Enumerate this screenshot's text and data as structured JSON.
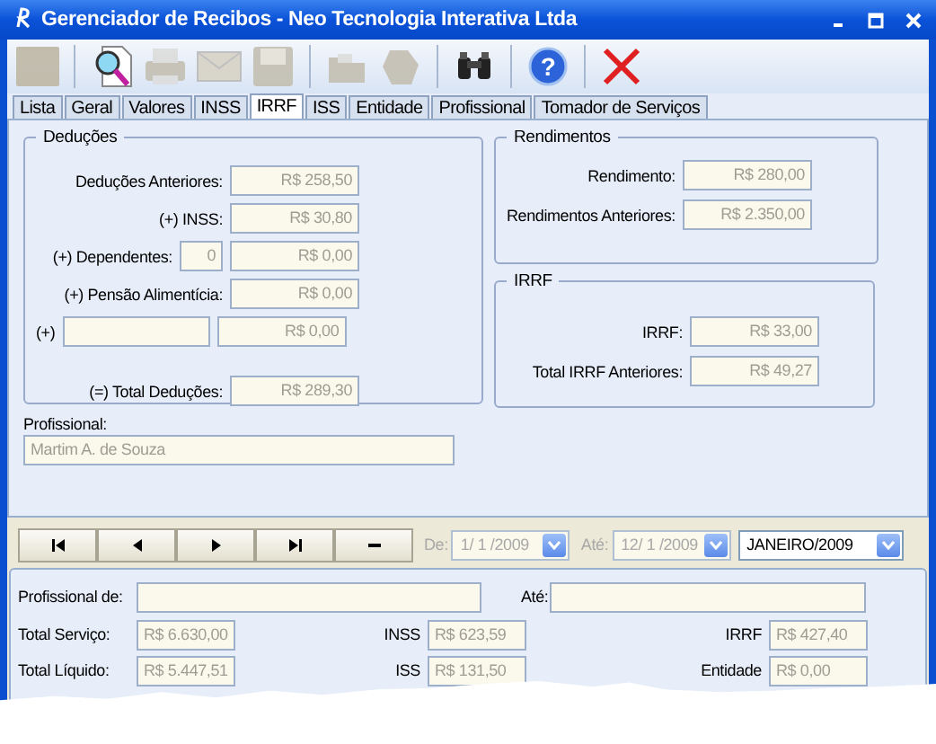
{
  "window": {
    "title": "Gerenciador de Recibos - Neo Tecnologia Interativa Ltda"
  },
  "toolbar": [
    {
      "kind": "blank",
      "disabled": true
    },
    {
      "kind": "preview",
      "disabled": false
    },
    {
      "kind": "print",
      "disabled": true
    },
    {
      "kind": "mail",
      "disabled": true
    },
    {
      "kind": "save",
      "disabled": true
    },
    {
      "kind": "folder",
      "disabled": true
    },
    {
      "kind": "blob",
      "disabled": true
    },
    {
      "kind": "find",
      "disabled": false
    },
    {
      "kind": "help",
      "disabled": false,
      "glyph": "?"
    },
    {
      "kind": "close",
      "disabled": false
    }
  ],
  "tabs": [
    {
      "label": "Lista",
      "selected": false
    },
    {
      "label": "Geral",
      "selected": false
    },
    {
      "label": "Valores",
      "selected": false
    },
    {
      "label": "INSS",
      "selected": false
    },
    {
      "label": "IRRF",
      "selected": true
    },
    {
      "label": "ISS",
      "selected": false
    },
    {
      "label": "Entidade",
      "selected": false
    },
    {
      "label": "Profissional",
      "selected": false
    },
    {
      "label": "Tomador de Serviços",
      "selected": false
    }
  ],
  "deducoes": {
    "title": "Deduções",
    "rows": [
      {
        "kind": "plain",
        "label": "Deduções Anteriores:",
        "value": "R$ 258,50"
      },
      {
        "kind": "plain",
        "label": "(+) INSS:",
        "value": "R$ 30,80"
      },
      {
        "kind": "count",
        "label": "(+) Dependentes:",
        "count": "0",
        "value": "R$ 0,00"
      },
      {
        "kind": "plain",
        "label": "(+) Pensão Alimentícia:",
        "value": "R$ 0,00"
      },
      {
        "kind": "other",
        "label": "(+)",
        "value": "R$ 0,00"
      },
      {
        "kind": "total",
        "label": "(=) Total Deduções:",
        "value": "R$ 289,30"
      }
    ]
  },
  "rendimentos": {
    "title": "Rendimentos",
    "rows": [
      {
        "label": "Rendimento:",
        "value": "R$ 280,00"
      },
      {
        "label": "Rendimentos Anteriores:",
        "value": "R$ 2.350,00"
      }
    ]
  },
  "irrf": {
    "title": "IRRF",
    "rows": [
      {
        "label": "IRRF:",
        "value": "R$ 33,00"
      },
      {
        "label": "Total IRRF Anteriores:",
        "value": "R$ 49,27"
      }
    ]
  },
  "profissional": {
    "label": "Profissional:",
    "value": "Martim A. de Souza"
  },
  "navigation": [
    {
      "kind": "first"
    },
    {
      "kind": "prev"
    },
    {
      "kind": "next"
    },
    {
      "kind": "last"
    },
    {
      "kind": "delete"
    }
  ],
  "filter": {
    "from_label": "De:",
    "from": "1/ 1 /2009",
    "to_label": "Até:",
    "to": "12/ 1 /2009",
    "month": "JANEIRO/2009"
  },
  "summary": {
    "from_label": "Profissional de:",
    "to_label": "Até:",
    "rows": [
      [
        {
          "label": "Total Serviço:",
          "value": "R$ 6.630,00"
        },
        {
          "label": "INSS",
          "value": "R$ 623,59"
        },
        {
          "label": "IRRF",
          "value": "R$ 427,40"
        }
      ],
      [
        {
          "label": "Total Líquido:",
          "value": "R$ 5.447,51"
        },
        {
          "label": "ISS",
          "value": "R$ 131,50"
        },
        {
          "label": "Entidade",
          "value": "R$ 0,00"
        }
      ]
    ]
  }
}
